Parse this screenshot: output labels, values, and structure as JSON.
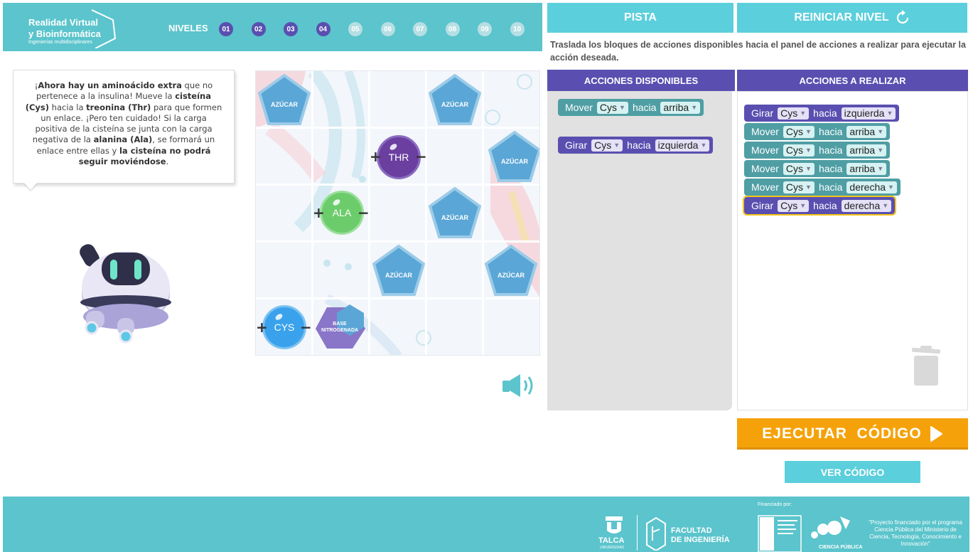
{
  "header": {
    "logo_line1": "Realidad Virtual",
    "logo_line2": "y Bioinformática",
    "logo_line3": "Ingenierías multidisciplinares",
    "levels_label": "NIVELES",
    "levels": [
      {
        "label": "01",
        "done": true
      },
      {
        "label": "02",
        "done": true
      },
      {
        "label": "03",
        "done": true
      },
      {
        "label": "04",
        "done": true
      },
      {
        "label": "05",
        "done": false
      },
      {
        "label": "06",
        "done": false
      },
      {
        "label": "07",
        "done": false
      },
      {
        "label": "08",
        "done": false
      },
      {
        "label": "09",
        "done": false
      },
      {
        "label": "10",
        "done": false
      }
    ]
  },
  "top_buttons": {
    "pista": "PISTA",
    "reiniciar": "REINICIAR NIVEL"
  },
  "instruction": "Traslada los bloques de acciones disponibles hacia el panel de acciones a realizar para ejecutar la acción deseada.",
  "bubble": {
    "p1": "¡",
    "b1": "Ahora hay un aminoácido extra",
    "p2": " que no pertenece a la insulina! Mueve la ",
    "b2": "cisteína (Cys)",
    "p3": " hacia la ",
    "b3": "treonina (Thr)",
    "p4": " para que formen un enlace. ¡Pero ten cuidado! Si la carga positiva de la cisteína se junta con la carga negativa de la ",
    "b4": "alanina (Ala)",
    "p5": ", se formará un enlace entre ellas y ",
    "b5": "la cisteína no podrá seguir moviéndose",
    "p6": "."
  },
  "board": {
    "sugar_label": "AZÚCAR",
    "base_label_1": "BASE",
    "base_label_2": "NITROGENADA",
    "thr": "THR",
    "ala": "ALA",
    "cys": "CYS"
  },
  "panels": {
    "available_title": "ACCIONES DISPONIBLES",
    "todo_title": "ACCIONES A REALIZAR",
    "available": [
      {
        "verb": "Mover",
        "target": "Cys",
        "prep": "hacia",
        "dir": "arriba",
        "kind": "move"
      },
      {
        "verb": "Girar",
        "target": "Cys",
        "prep": "hacia",
        "dir": "izquierda",
        "kind": "turn"
      }
    ],
    "todo": [
      {
        "verb": "Girar",
        "target": "Cys",
        "prep": "hacia",
        "dir": "izquierda",
        "kind": "turn"
      },
      {
        "verb": "Mover",
        "target": "Cys",
        "prep": "hacia",
        "dir": "arriba",
        "kind": "move"
      },
      {
        "verb": "Mover",
        "target": "Cys",
        "prep": "hacia",
        "dir": "arriba",
        "kind": "move"
      },
      {
        "verb": "Mover",
        "target": "Cys",
        "prep": "hacia",
        "dir": "arriba",
        "kind": "move"
      },
      {
        "verb": "Mover",
        "target": "Cys",
        "prep": "hacia",
        "dir": "derecha",
        "kind": "move"
      },
      {
        "verb": "Girar",
        "target": "Cys",
        "prep": "hacia",
        "dir": "derecha",
        "kind": "turn",
        "selected": true
      }
    ]
  },
  "ejecutar": "EJECUTAR  CÓDIGO",
  "ver_codigo": "VER CÓDIGO",
  "footer": {
    "talca": "TALCA",
    "talca_sub": "UNIVERSIDAD",
    "facultad_1": "FACULTAD",
    "facultad_2": "DE INGENIERÍA",
    "financiado": "Financiado por:",
    "ciencia": "CIENCIA PÚBLICA",
    "proyecto": "\"Proyecto financiado por el programa Ciencia Pública del Ministerio de Ciencia, Tecnología, Conocimiento e Innovación\""
  },
  "colors": {
    "teal": "#5bc4cc",
    "purple": "#5a4fb0",
    "move_block": "#4f9ea4",
    "orange": "#f5a20a",
    "sugar_blue": "#5aa6d6"
  }
}
